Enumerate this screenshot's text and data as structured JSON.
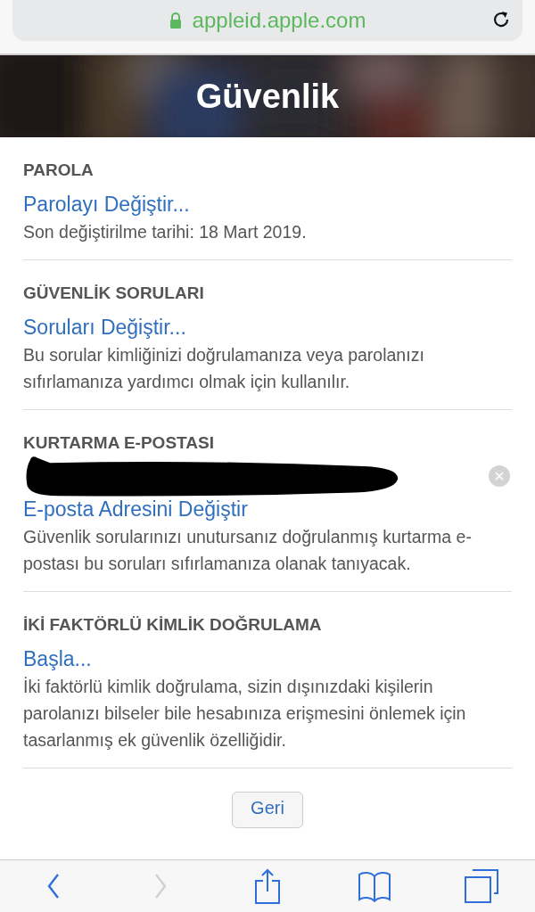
{
  "address_bar": {
    "url": "appleid.apple.com",
    "secure": true
  },
  "banner": {
    "title": "Güvenlik"
  },
  "sections": [
    {
      "kind": "plain",
      "heading": "PAROLA",
      "link": "Parolayı Değiştir...",
      "description": "Son değiştirilme tarihi: 18 Mart 2019."
    },
    {
      "kind": "plain",
      "heading": "GÜVENLİK SORULARI",
      "link": "Soruları Değiştir...",
      "description": "Bu sorular kimliğinizi doğrulamanıza veya parolanızı sıfırlamanıza yardımcı olmak için kullanılır."
    },
    {
      "kind": "email",
      "heading": "KURTARMA E-POSTASI",
      "link": "E-posta Adresini Değiştir",
      "description": "Güvenlik sorularınızı unutursanız doğrulanmış kurtarma e-postası bu soruları sıfırlamanıza olanak tanıyacak."
    },
    {
      "kind": "plain",
      "heading": "İKİ FAKTÖRLÜ KİMLİK DOĞRULAMA",
      "link": "Başla...",
      "description": "İki faktörlü kimlik doğrulama, sizin dışınızdaki kişilerin parolanızı bilseler bile hesabınıza erişmesini önlemek için tasarlanmış ek güvenlik özelliğidir."
    }
  ],
  "back_button": "Geri",
  "toolbar": [
    {
      "kind": "back",
      "disabled": false
    },
    {
      "kind": "forward",
      "disabled": true
    },
    {
      "kind": "share",
      "disabled": false
    },
    {
      "kind": "bookmarks",
      "disabled": false
    },
    {
      "kind": "tabs",
      "disabled": false
    }
  ]
}
